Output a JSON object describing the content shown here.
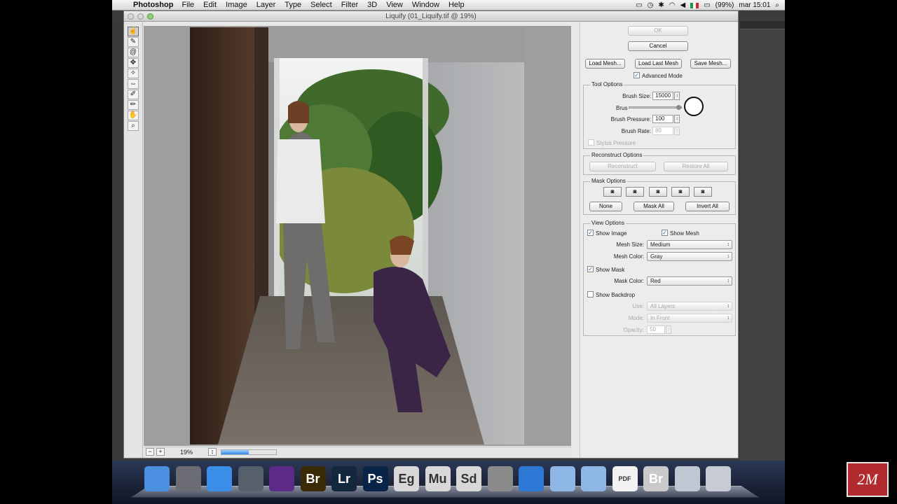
{
  "menubar": {
    "app": "Photoshop",
    "items": [
      "File",
      "Edit",
      "Image",
      "Layer",
      "Type",
      "Select",
      "Filter",
      "3D",
      "View",
      "Window",
      "Help"
    ],
    "battery": "(99%)",
    "clock": "mar 15:01"
  },
  "window": {
    "title": "Liquify (01_Liquify.tif @ 19%)"
  },
  "tools": [
    "forward-warp",
    "reconstruct",
    "twirl-clockwise",
    "pucker",
    "bloat",
    "push-left",
    "freeze-mask",
    "thaw-mask",
    "hand",
    "zoom"
  ],
  "status": {
    "zoom": "19%",
    "progress_fraction": 0.5
  },
  "buttons": {
    "ok": "OK",
    "cancel": "Cancel",
    "load_mesh": "Load Mesh...",
    "load_last_mesh": "Load Last Mesh",
    "save_mesh": "Save Mesh..."
  },
  "advanced_mode": {
    "label": "Advanced Mode",
    "checked": true
  },
  "tool_options": {
    "title": "Tool Options",
    "brush_size_label": "Brush Size:",
    "brush_size_value": "15000",
    "brush_density_label": "Brus",
    "brush_pressure_label": "Brush Pressure:",
    "brush_pressure_value": "100",
    "brush_rate_label": "Brush Rate:",
    "brush_rate_value": "80",
    "stylus_label": "Stylus Pressure"
  },
  "reconstruct_options": {
    "title": "Reconstruct Options",
    "reconstruct": "Reconstruct",
    "restore_all": "Restore All"
  },
  "mask_options": {
    "title": "Mask Options",
    "none": "None",
    "mask_all": "Mask All",
    "invert_all": "Invert All"
  },
  "view_options": {
    "title": "View Options",
    "show_image": "Show Image",
    "show_mesh": "Show Mesh",
    "mesh_size_label": "Mesh Size:",
    "mesh_size_value": "Medium",
    "mesh_color_label": "Mesh Color:",
    "mesh_color_value": "Gray",
    "show_mask": "Show Mask",
    "mask_color_label": "Mask Color:",
    "mask_color_value": "Red",
    "show_backdrop": "Show Backdrop",
    "use_label": "Use:",
    "use_value": "All Layers",
    "mode_label": "Mode:",
    "mode_value": "In Front",
    "opacity_label": "Opacity:",
    "opacity_value": "50"
  },
  "dock": [
    {
      "name": "finder",
      "label": "",
      "color": "#4b8fe0"
    },
    {
      "name": "launchpad",
      "label": "",
      "color": "#6c6c74"
    },
    {
      "name": "safari",
      "label": "",
      "color": "#3a8ee8"
    },
    {
      "name": "image-capture",
      "label": "",
      "color": "#55606a"
    },
    {
      "name": "creative-cloud",
      "label": "",
      "color": "#5c2a87"
    },
    {
      "name": "bridge",
      "label": "Br",
      "color": "#3a2a06"
    },
    {
      "name": "lightroom",
      "label": "Lr",
      "color": "#13283c"
    },
    {
      "name": "photoshop",
      "label": "Ps",
      "color": "#0a2447"
    },
    {
      "name": "app-eg",
      "label": "Eg",
      "color": "#d8d8d8"
    },
    {
      "name": "app-mu",
      "label": "Mu",
      "color": "#d8d8d8"
    },
    {
      "name": "app-sd",
      "label": "Sd",
      "color": "#d8d8d8"
    },
    {
      "name": "system-preferences",
      "label": "",
      "color": "#8a8a8a"
    },
    {
      "name": "quicktime",
      "label": "",
      "color": "#2c78d4"
    },
    {
      "name": "applications-folder",
      "label": "",
      "color": "#8fb7e6"
    },
    {
      "name": "documents-folder",
      "label": "",
      "color": "#8fb7e6"
    },
    {
      "name": "pdf-document",
      "label": "PDF",
      "color": "#f2f2f2"
    },
    {
      "name": "bridge-document",
      "label": "Br",
      "color": "#c9c9c9"
    },
    {
      "name": "screenshot-stack",
      "label": "",
      "color": "#bfc7d2"
    },
    {
      "name": "trash",
      "label": "",
      "color": "#c7ccd4"
    }
  ],
  "brand_logo": "2M"
}
